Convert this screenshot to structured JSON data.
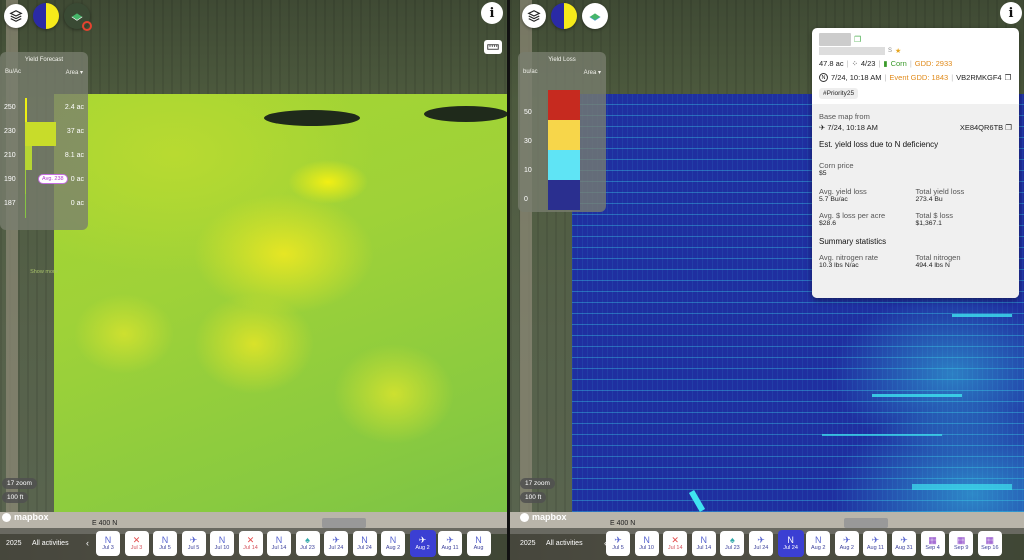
{
  "left": {
    "zoom": "17 zoom",
    "scale": "100 ft",
    "attribution": "mapbox",
    "road_label": "E 400 N",
    "legend": {
      "title": "Yield Forecast",
      "unit": "Bu/Ac",
      "area_label": "Area",
      "avg_label": "Avg. 238",
      "show_more": "Show more",
      "rows": [
        {
          "value": "250",
          "area": "2.4 ac"
        },
        {
          "value": "230",
          "area": "37 ac"
        },
        {
          "value": "210",
          "area": "8.1 ac"
        },
        {
          "value": "190",
          "area": "0 ac"
        },
        {
          "value": "187",
          "area": "0 ac"
        }
      ],
      "fractions": [
        0.05,
        0.78,
        0.17,
        0.0,
        0.0
      ]
    }
  },
  "right": {
    "zoom": "17 zoom",
    "scale": "100 ft",
    "attribution": "mapbox",
    "road_label": "E 400 N",
    "legend": {
      "title": "Yield Loss",
      "unit": "bu/ac",
      "area_label": "Area",
      "ticks": [
        "50",
        "30",
        "10",
        "0"
      ],
      "colors": [
        "#c62a1f",
        "#f7d64a",
        "#5fe4f5",
        "#2a2f8f"
      ]
    }
  },
  "card": {
    "redacted_suffix": "S",
    "acres": "47.8 ac",
    "date_count": "4/23",
    "crop": "Corn",
    "gdd": "GDD: 2933",
    "flight": "7/24, 10:18 AM",
    "event_gdd": "Event GDD: 1843",
    "code": "VB2RMKGF4",
    "tag": "#Priority25",
    "base_map_label": "Base map from",
    "base_map_date": "7/24, 10:18 AM",
    "base_map_code": "XE84QR6TB",
    "section_title": "Est. yield loss due to N deficiency",
    "corn_price_label": "Corn price",
    "corn_price": "$5",
    "stats": [
      {
        "label": "Avg. yield loss",
        "value": "5.7 Bu/ac"
      },
      {
        "label": "Total yield loss",
        "value": "273.4 Bu"
      },
      {
        "label": "Avg. $ loss per acre",
        "value": "$28.6"
      },
      {
        "label": "Total $ loss",
        "value": "$1,367.1"
      }
    ],
    "summary_title": "Summary statistics",
    "summary": [
      {
        "label": "Avg. nitrogen rate",
        "value": "10.3 lbs N/ac"
      },
      {
        "label": "Total nitrogen",
        "value": "494.4 lbs N"
      }
    ],
    "colors": {
      "corn": "#3a9a2a",
      "gdd": "#e08a1a",
      "event_gdd": "#e08a1a"
    }
  },
  "timeline_left": {
    "year": "2025",
    "all": "All activities",
    "chips": [
      {
        "icon": "N",
        "label": "Jul 3",
        "kind": "n"
      },
      {
        "icon": "✕",
        "label": "Jul 3",
        "kind": "red"
      },
      {
        "icon": "N",
        "label": "Jul 5",
        "kind": "n"
      },
      {
        "icon": "✈",
        "label": "Jul 5",
        "kind": "n"
      },
      {
        "icon": "N",
        "label": "Jul 10",
        "kind": "n"
      },
      {
        "icon": "✕",
        "label": "Jul 14",
        "kind": "red"
      },
      {
        "icon": "N",
        "label": "Jul 14",
        "kind": "n"
      },
      {
        "icon": "♠",
        "label": "Jul 23",
        "kind": "teal"
      },
      {
        "icon": "✈",
        "label": "Jul 24",
        "kind": "n"
      },
      {
        "icon": "N",
        "label": "Jul 24",
        "kind": "n"
      },
      {
        "icon": "N",
        "label": "Aug 2",
        "kind": "n"
      },
      {
        "icon": "✈",
        "label": "Aug 2",
        "kind": "active"
      },
      {
        "icon": "✈",
        "label": "Aug 11",
        "kind": "n"
      },
      {
        "icon": "N",
        "label": "Aug",
        "kind": "n"
      }
    ]
  },
  "timeline_right": {
    "year": "2025",
    "all": "All activities",
    "chips": [
      {
        "icon": "✈",
        "label": "Jul 5",
        "kind": "n"
      },
      {
        "icon": "N",
        "label": "Jul 10",
        "kind": "n"
      },
      {
        "icon": "✕",
        "label": "Jul 14",
        "kind": "red"
      },
      {
        "icon": "N",
        "label": "Jul 14",
        "kind": "n"
      },
      {
        "icon": "♠",
        "label": "Jul 23",
        "kind": "teal"
      },
      {
        "icon": "✈",
        "label": "Jul 24",
        "kind": "n"
      },
      {
        "icon": "N",
        "label": "Jul 24",
        "kind": "active"
      },
      {
        "icon": "N",
        "label": "Aug 2",
        "kind": "n"
      },
      {
        "icon": "✈",
        "label": "Aug 2",
        "kind": "n"
      },
      {
        "icon": "✈",
        "label": "Aug 11",
        "kind": "n"
      },
      {
        "icon": "✈",
        "label": "Aug 31",
        "kind": "n"
      },
      {
        "icon": "▦",
        "label": "Sep 4",
        "kind": "purple"
      },
      {
        "icon": "▦",
        "label": "Sep 9",
        "kind": "purple"
      },
      {
        "icon": "▦",
        "label": "Sep 16",
        "kind": "purple"
      }
    ]
  }
}
